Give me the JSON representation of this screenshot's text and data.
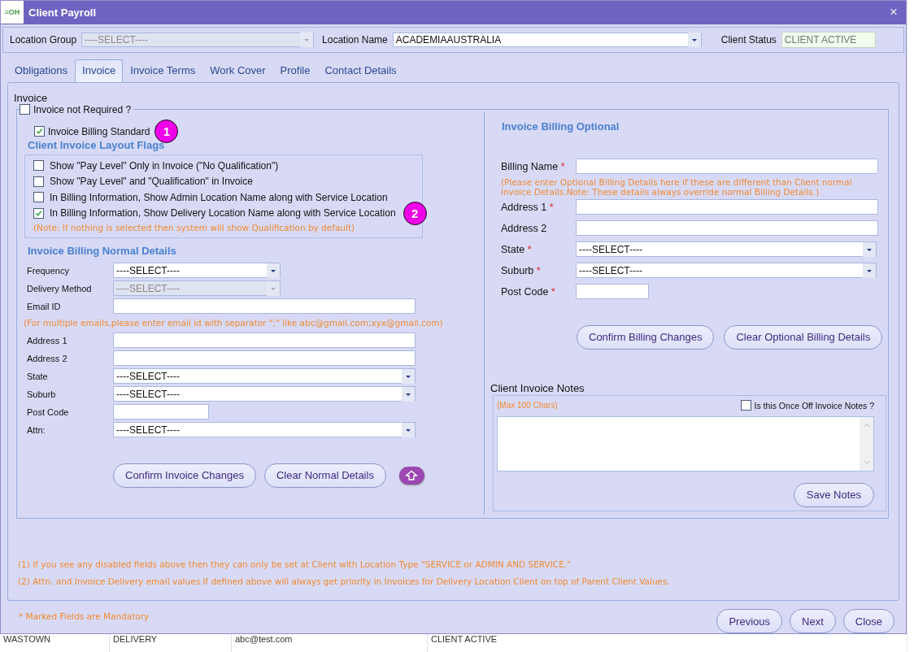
{
  "window": {
    "logo": "≡OH",
    "title": "Client Payroll",
    "close": "×"
  },
  "header": {
    "fields": [
      {
        "label": "Location Group",
        "kind": "select",
        "value": "----SELECT----",
        "disabled": true
      },
      {
        "label": "Location Name",
        "kind": "select",
        "value": "ACADEMIAAUSTRALIA",
        "disabled": false
      },
      {
        "label": "Client Status",
        "kind": "status",
        "value": "CLIENT ACTIVE"
      }
    ]
  },
  "tabs": [
    {
      "label": "Obligations",
      "selected": false
    },
    {
      "label": "Invoice",
      "selected": true
    },
    {
      "label": "Invoice Terms",
      "selected": false
    },
    {
      "label": "Work Cover",
      "selected": false
    },
    {
      "label": "Profile",
      "selected": false
    },
    {
      "label": "Contact Details",
      "selected": false
    }
  ],
  "panel_title": "Invoice",
  "invoice_not_required": {
    "label": "Invoice not Required ?",
    "checked": false
  },
  "billing_standard": {
    "label": "Invoice Billing Standard",
    "checked": true,
    "marker": "1"
  },
  "layout_flags": {
    "title": "Client Invoice Layout Flags",
    "items": [
      {
        "label": "Show \"Pay Level\" Only in Invoice (\"No Qualification\")",
        "checked": false
      },
      {
        "label": "Show \"Pay Level\" and \"Qualification\" in Invoice",
        "checked": false
      },
      {
        "label": "In Billing Information, Show Admin Location Name along with Service Location",
        "checked": false
      },
      {
        "label": "In Billing Information, Show Delivery Location Name along with Service Location",
        "checked": true,
        "marker": "2"
      }
    ],
    "note": "(Note: If nothing is selected then system will show Qualification by default)"
  },
  "normal_details": {
    "title": "Invoice Billing Normal Details",
    "fields": [
      {
        "kind": "picker",
        "label": "Frequency",
        "value": "----SELECT----",
        "disabled": false
      },
      {
        "kind": "picker",
        "label": "Delivery Method",
        "value": "----SELECT----",
        "disabled": true
      },
      {
        "kind": "text",
        "label": "Email ID"
      },
      {
        "kind": "hint",
        "text": "(For multiple emails,please enter email id with separator \";\" like abc@gmail.com;xyx@gmail.com)"
      },
      {
        "kind": "text",
        "label": "Address 1"
      },
      {
        "kind": "text",
        "label": "Address 2"
      },
      {
        "kind": "select",
        "label": "State",
        "value": "----SELECT----"
      },
      {
        "kind": "select",
        "label": "Suburb",
        "value": "----SELECT----"
      },
      {
        "kind": "code",
        "label": "Post Code"
      },
      {
        "kind": "select",
        "label": "Attn:",
        "value": "----SELECT----"
      }
    ],
    "buttons": [
      "Confirm Invoice Changes",
      "Clear Normal Details"
    ]
  },
  "optional_billing": {
    "title": "Invoice Billing Optional",
    "fields": [
      {
        "kind": "text",
        "label": "Billing Name",
        "required_mark": "*"
      },
      {
        "kind": "hint",
        "text": "(Please enter Optional Billing Details here if these are different than Client normal Invoice Details.Note: These details always override normal Billing Details.)"
      },
      {
        "kind": "text",
        "label": "Address 1",
        "required_mark": "*"
      },
      {
        "kind": "text",
        "label": "Address 2"
      },
      {
        "kind": "select",
        "label": "State",
        "required_mark": "*",
        "value": "----SELECT----"
      },
      {
        "kind": "select",
        "label": "Suburb",
        "required_mark": "*",
        "value": "----SELECT----"
      },
      {
        "kind": "code",
        "label": "Post Code",
        "required_mark": "*"
      }
    ],
    "buttons": [
      "Confirm Billing Changes",
      "Clear Optional Billing Details"
    ]
  },
  "notes": {
    "title": "Client Invoice Notes",
    "hint": "(Max 100 Chars)",
    "once_off": {
      "label": "Is this Once Off Invoice Notes ?",
      "checked": false
    },
    "button": "Save Notes"
  },
  "footnotes": [
    "(1) If you see any disabled fields above then they can only be set at Client with Location Type \"SERVICE or ADMIN AND SERVICE.\"",
    "(2) Attn. and Invoice Delivery email values if defined above will always get priority in Invoices for Delivery Location Client on top of Parent Client Values."
  ],
  "mandatory_note": "* Marked Fields are Mandatory",
  "nav_buttons": [
    "Previous",
    "Next",
    "Close"
  ],
  "background_row": [
    "WASTOWN",
    "DELIVERY",
    "abc@test.com",
    "CLIENT ACTIVE"
  ]
}
